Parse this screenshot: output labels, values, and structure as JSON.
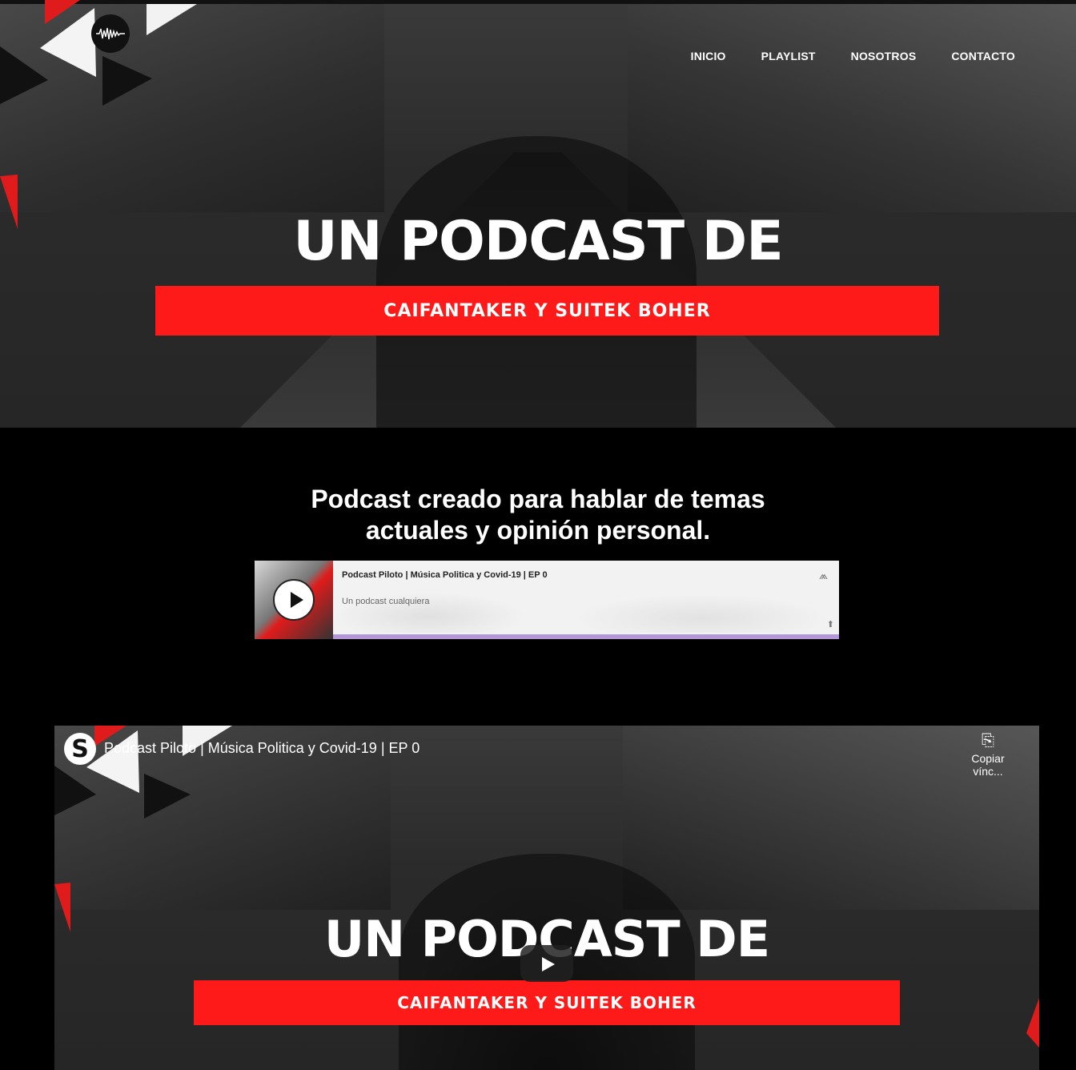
{
  "nav": {
    "items": [
      {
        "label": "INICIO"
      },
      {
        "label": "PLAYLIST"
      },
      {
        "label": "NOSOTROS"
      },
      {
        "label": "CONTACTO"
      }
    ]
  },
  "hero": {
    "title": "UN PODCAST DE",
    "band": "CAIFANTAKER Y SUITEK BOHER",
    "logo_icon": "waveform-icon"
  },
  "intro": {
    "tagline_line1": "Podcast creado para hablar de temas",
    "tagline_line2": "actuales y opinión personal."
  },
  "player": {
    "title": "Podcast Piloto | Música Politica y Covid-19 | EP 0",
    "subtitle": "Un podcast cualquiera",
    "play_icon": "play-icon",
    "brand_icon": "anchor-icon",
    "share_icon": "share-icon"
  },
  "video": {
    "channel_letter": "S",
    "title": "Podcast Piloto | Música Politica y Covid-19 | EP 0",
    "copy_label": "Copiar vínc...",
    "cover_title": "UN PODCAST DE",
    "cover_band": "CAIFANTAKER Y SUITEK BOHER"
  },
  "colors": {
    "accent_red": "#ff1a1a",
    "progress_purple": "#b497d6",
    "background": "#000000"
  }
}
